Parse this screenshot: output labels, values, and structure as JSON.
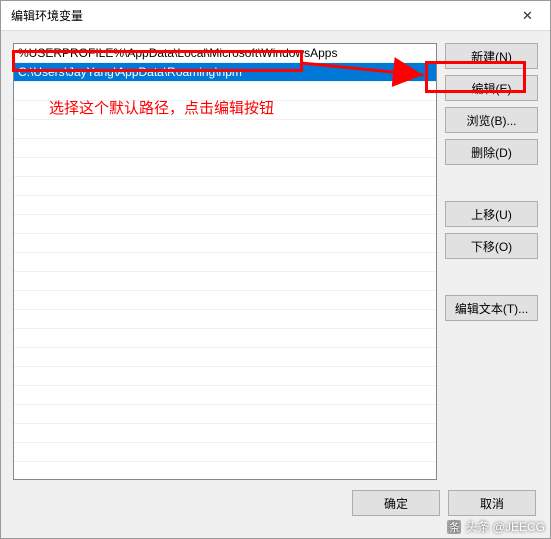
{
  "window": {
    "title": "编辑环境变量",
    "close_symbol": "✕"
  },
  "list": {
    "items": [
      {
        "text": "%USERPROFILE%\\AppData\\Local\\Microsoft\\WindowsApps",
        "selected": false
      },
      {
        "text": "C:\\Users\\JayYang\\AppData\\Roaming\\npm",
        "selected": true
      }
    ]
  },
  "buttons": {
    "new": "新建(N)",
    "edit": "编辑(E)",
    "browse": "浏览(B)...",
    "delete": "删除(D)",
    "move_up": "上移(U)",
    "move_down": "下移(O)",
    "edit_text": "编辑文本(T)...",
    "ok": "确定",
    "cancel": "取消"
  },
  "annotation": {
    "hint": "选择这个默认路径，点击编辑按钮"
  },
  "watermark": {
    "icon": "条",
    "text": "头条 @JEECG"
  }
}
